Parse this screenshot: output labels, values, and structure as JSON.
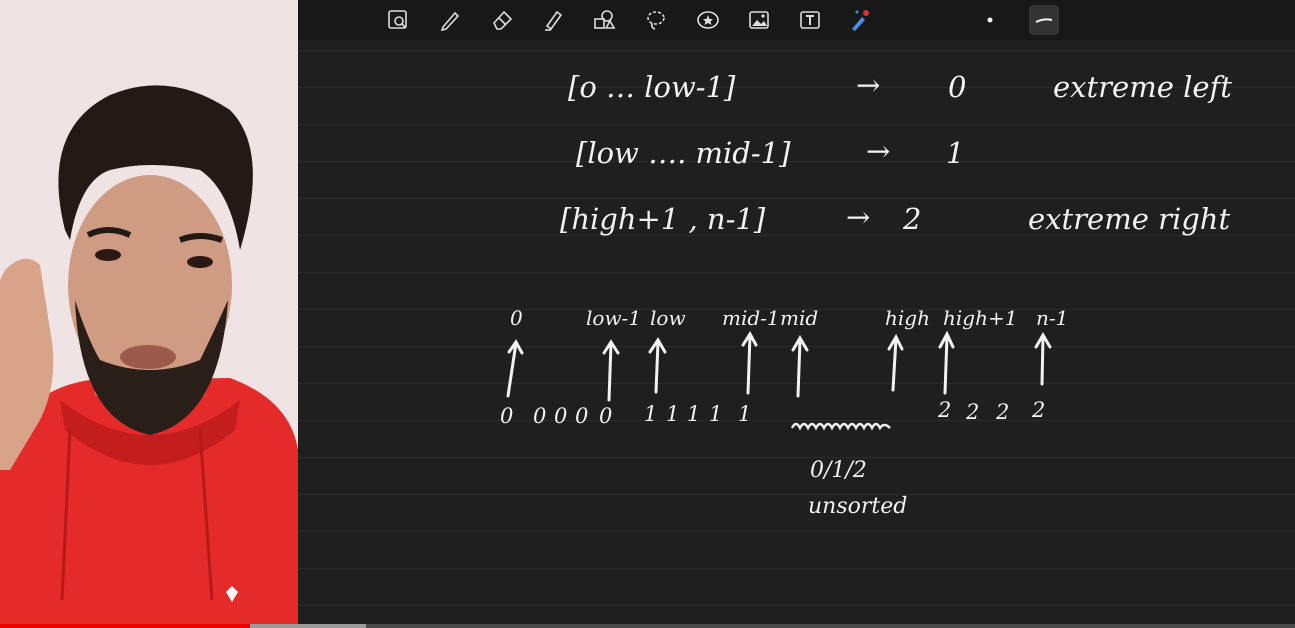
{
  "toolbar": {
    "tools": [
      {
        "icon": "page-zoom-icon"
      },
      {
        "icon": "pen-icon"
      },
      {
        "icon": "eraser-icon"
      },
      {
        "icon": "highlighter-icon"
      },
      {
        "icon": "shapes-icon"
      },
      {
        "icon": "lasso-icon"
      },
      {
        "icon": "sticker-icon"
      },
      {
        "icon": "image-icon"
      },
      {
        "icon": "text-box-icon"
      },
      {
        "icon": "laser-pointer-icon"
      },
      {
        "icon": "color-dot-icon"
      },
      {
        "icon": "stroke-width-icon",
        "active": true
      }
    ]
  },
  "notes": {
    "line1": {
      "range": "[o … low-1]",
      "arrow": "→",
      "value": "0",
      "comment": "extreme left"
    },
    "line2": {
      "range": "[low …. mid-1]",
      "arrow": "→",
      "value": "1"
    },
    "line3": {
      "range": "[high+1 , n-1]",
      "arrow": "→",
      "value": "2",
      "comment": "extreme right"
    }
  },
  "diagram": {
    "labels": {
      "zero": "0",
      "low_minus_1": "low-1",
      "low": "low",
      "mid_minus_1": "mid-1",
      "mid": "mid",
      "high": "high",
      "high_plus_1": "high+1",
      "n_minus_1": "n-1"
    },
    "zeros": [
      "0",
      "0",
      "0",
      "0",
      "0"
    ],
    "ones": [
      "1",
      "1",
      "1",
      "1",
      "1"
    ],
    "twos": [
      "2",
      "2",
      "2",
      "2"
    ],
    "choices": "0/1/2",
    "status": "unsorted"
  },
  "player": {
    "progress": 0.193,
    "buffered": 0.283
  },
  "colors": {
    "board": "#1f1f1f",
    "ink": "#f2f2f2",
    "progress": "#ee0000",
    "hoodie": "#e52a2a"
  }
}
